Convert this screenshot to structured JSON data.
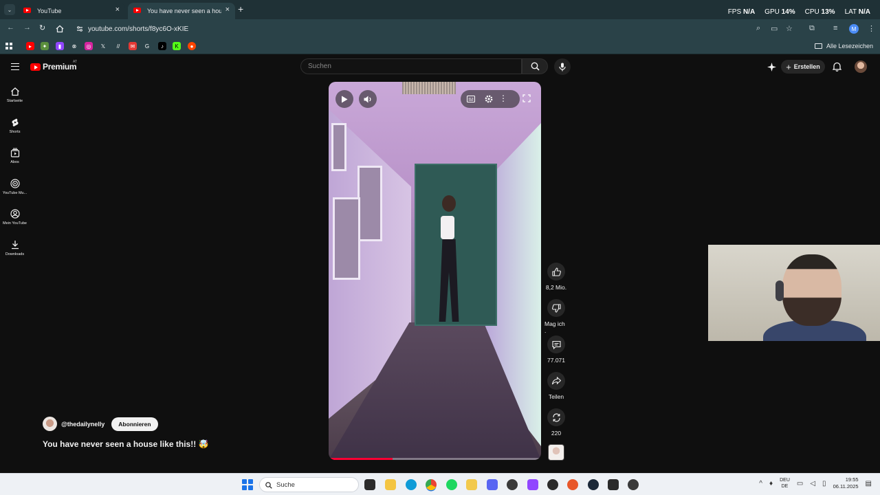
{
  "browser": {
    "tabs": [
      {
        "title": "YouTube",
        "active": false
      },
      {
        "title": "You have never seen a house lik",
        "active": true
      }
    ],
    "tab_close_icon": "×",
    "new_tab_icon": "+",
    "url": "youtube.com/shorts/f8yc6O-xKIE",
    "bookmarks_folder": "Alle Lesezeichen",
    "profile_initial": "M"
  },
  "overlay_stats": {
    "fps_label": "FPS",
    "fps_value": "N/A",
    "gpu_label": "GPU",
    "gpu_value": "14%",
    "cpu_label": "CPU",
    "cpu_value": "13%",
    "lat_label": "LAT",
    "lat_value": "N/A"
  },
  "youtube": {
    "brand": "Premium",
    "region": "AT",
    "search_placeholder": "Suchen",
    "create_label": "Erstellen",
    "guide": [
      {
        "label": "Startseite",
        "icon": "home-icon"
      },
      {
        "label": "Shorts",
        "icon": "shorts-icon"
      },
      {
        "label": "Abos",
        "icon": "subscriptions-icon"
      },
      {
        "label": "YouTube Mu...",
        "icon": "music-icon"
      },
      {
        "label": "Mein YouTube",
        "icon": "account-icon"
      },
      {
        "label": "Downloads",
        "icon": "download-icon"
      }
    ],
    "actions": {
      "likes": "8,2 Mio.",
      "dislike": "Mag ich .",
      "comments": "77.071",
      "share": "Teilen",
      "remix": "220"
    },
    "channel": {
      "handle": "@thedailynelly",
      "subscribe_label": "Abonnieren"
    },
    "short_title": "You have never seen a house like this!! 🤯",
    "progress_fraction": 0.3
  },
  "taskbar": {
    "search_placeholder": "Suche",
    "lang_top": "DEU",
    "lang_bottom": "DE",
    "time": "19:55",
    "date": "06.11.2025"
  }
}
